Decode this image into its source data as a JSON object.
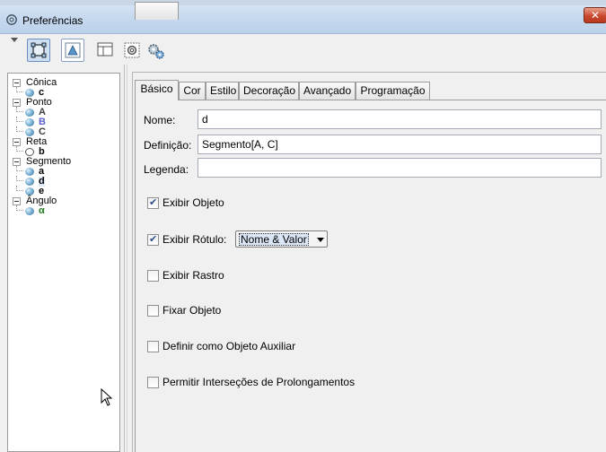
{
  "window": {
    "title": "Preferências"
  },
  "toolbar": {
    "buttons": [
      {
        "icon": "graphics-view-icon",
        "selected": true
      },
      {
        "icon": "graphics-view-2-icon",
        "selected": false
      },
      {
        "icon": "layout-icon",
        "selected": false
      },
      {
        "icon": "defaults-icon",
        "selected": false
      },
      {
        "icon": "advanced-settings-icon",
        "selected": false
      }
    ]
  },
  "tree": {
    "groups": [
      {
        "label": "Cônica",
        "items": [
          {
            "label": "c",
            "color": "#000000",
            "shape": "filled"
          }
        ]
      },
      {
        "label": "Ponto",
        "items": [
          {
            "label": "A",
            "color": "#3d3d3d",
            "shape": "filled"
          },
          {
            "label": "B",
            "color": "#5c5ccf",
            "shape": "filled"
          },
          {
            "label": "C",
            "color": "#3d3d3d",
            "shape": "filled"
          }
        ]
      },
      {
        "label": "Reta",
        "items": [
          {
            "label": "b",
            "color": "#000000",
            "shape": "hollow"
          }
        ]
      },
      {
        "label": "Segmento",
        "items": [
          {
            "label": "a",
            "color": "#000000",
            "shape": "filled"
          },
          {
            "label": "d",
            "color": "#000000",
            "shape": "filled",
            "selected": true
          },
          {
            "label": "e",
            "color": "#000000",
            "shape": "filled"
          }
        ]
      },
      {
        "label": "Ângulo",
        "items": [
          {
            "label": "α",
            "color": "#1f7a1f",
            "shape": "filled"
          }
        ]
      }
    ]
  },
  "tabs": [
    "Básico",
    "Cor",
    "Estilo",
    "Decoração",
    "Avançado",
    "Programação"
  ],
  "basic": {
    "name_label": "Nome:",
    "name_value": "d",
    "definition_label": "Definição:",
    "definition_value": "Segmento[A, C]",
    "caption_label": "Legenda:",
    "caption_value": "",
    "show_object": {
      "label": "Exibir Objeto",
      "checked": true
    },
    "show_label": {
      "label": "Exibir Rótulo:",
      "checked": true,
      "selected_option": "Nome & Valor"
    },
    "show_trace": {
      "label": "Exibir Rastro",
      "checked": false
    },
    "fix_object": {
      "label": "Fixar Objeto",
      "checked": false
    },
    "auxiliary": {
      "label": "Definir como Objeto Auxiliar",
      "checked": false
    },
    "intersections": {
      "label": "Permitir Interseções de Prolongamentos",
      "checked": false
    }
  },
  "colors": {
    "selection": "#dde9f7",
    "accent": "#2a4f8a"
  }
}
